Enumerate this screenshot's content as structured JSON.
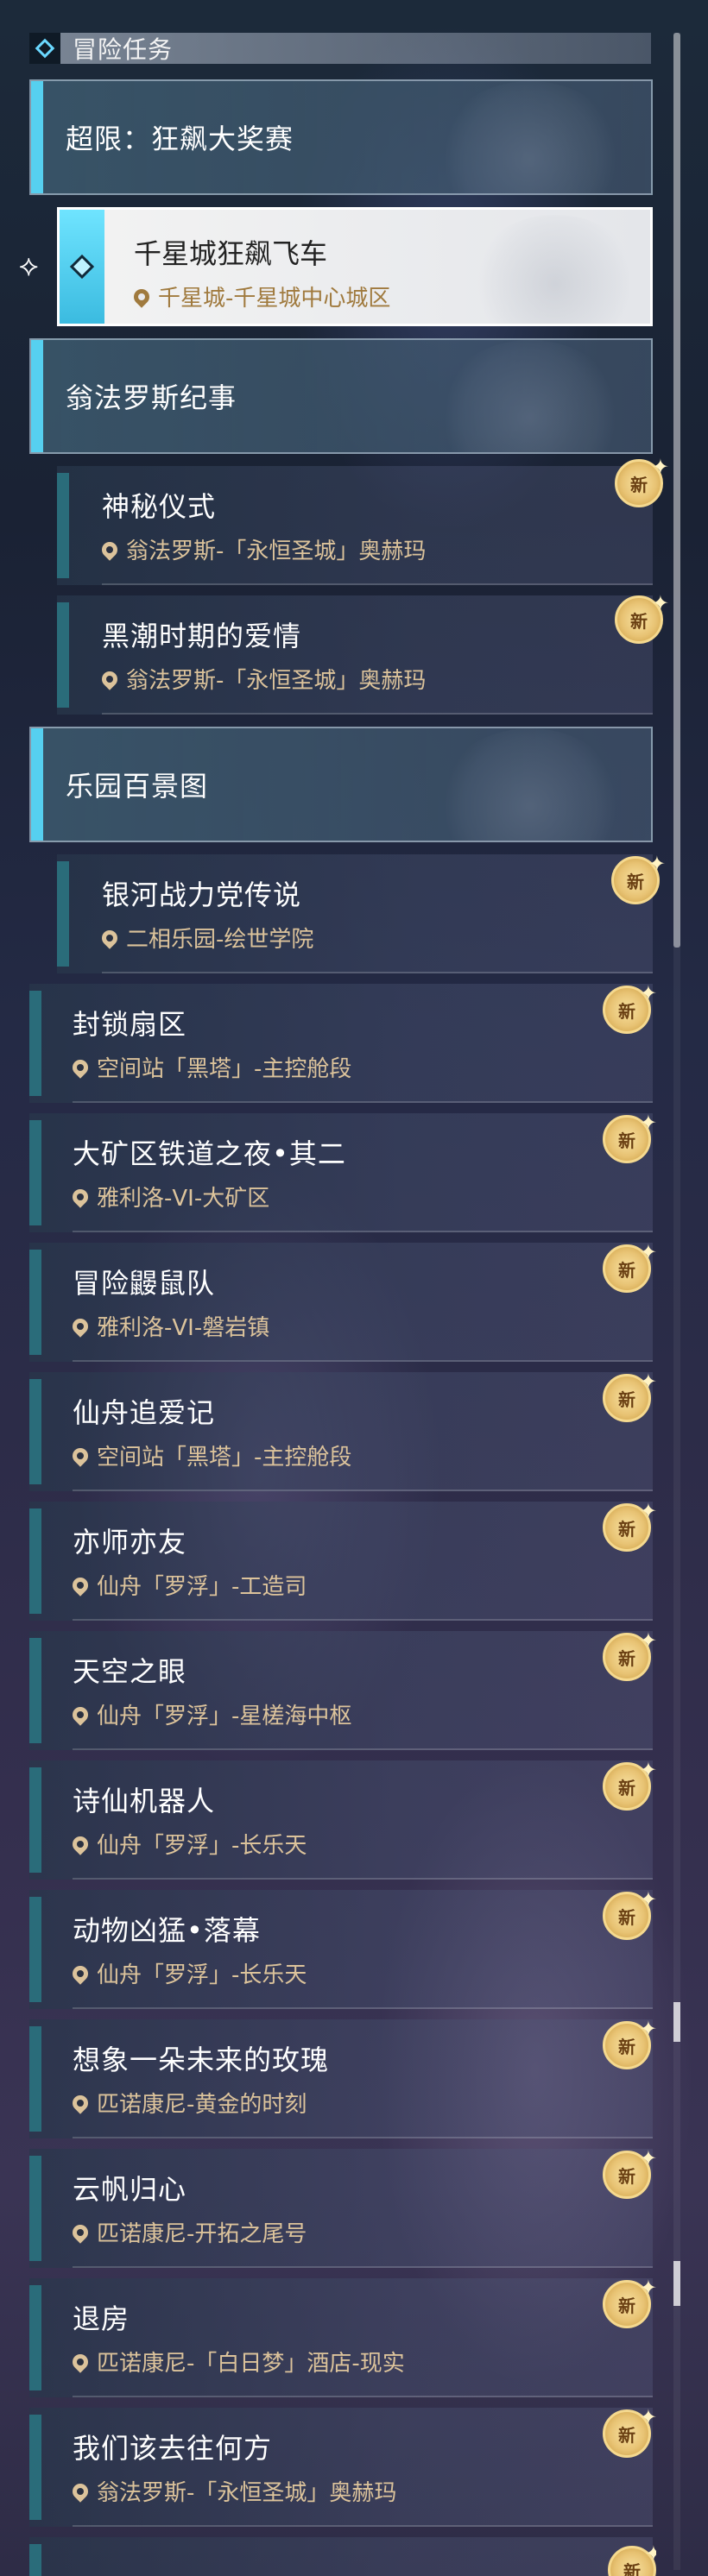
{
  "header": {
    "title": "冒险任务"
  },
  "categories": [
    {
      "label": "超限：狂飙大奖赛"
    },
    {
      "label": "翁法罗斯纪事"
    },
    {
      "label": "乐园百景图"
    }
  ],
  "selected_quest": {
    "title": "千星城狂飙飞车",
    "location": "千星城-千星城中心城区"
  },
  "quests": [
    {
      "title": "神秘仪式",
      "location": "翁法罗斯-「永恒圣城」奥赫玛",
      "badge": "新"
    },
    {
      "title": "黑潮时期的爱情",
      "location": "翁法罗斯-「永恒圣城」奥赫玛",
      "badge": "新"
    },
    {
      "title": "银河战力党传说",
      "location": "二相乐园-绘世学院",
      "badge": "新"
    },
    {
      "title": "封锁扇区",
      "location": "空间站「黑塔」-主控舱段",
      "badge": "新"
    },
    {
      "title": "大矿区铁道之夜•其二",
      "location": "雅利洛-VI-大矿区",
      "badge": "新"
    },
    {
      "title": "冒险鼹鼠队",
      "location": "雅利洛-VI-磐岩镇",
      "badge": "新"
    },
    {
      "title": "仙舟追爱记",
      "location": "空间站「黑塔」-主控舱段",
      "badge": "新"
    },
    {
      "title": "亦师亦友",
      "location": "仙舟「罗浮」-工造司",
      "badge": "新"
    },
    {
      "title": "天空之眼",
      "location": "仙舟「罗浮」-星槎海中枢",
      "badge": "新"
    },
    {
      "title": "诗仙机器人",
      "location": "仙舟「罗浮」-长乐天",
      "badge": "新"
    },
    {
      "title": "动物凶猛•落幕",
      "location": "仙舟「罗浮」-长乐天",
      "badge": "新"
    },
    {
      "title": "想象一朵未来的玫瑰",
      "location": "匹诺康尼-黄金的时刻",
      "badge": "新"
    },
    {
      "title": "云帆归心",
      "location": "匹诺康尼-开拓之尾号",
      "badge": "新"
    },
    {
      "title": "退房",
      "location": "匹诺康尼-「白日梦」酒店-现实",
      "badge": "新"
    },
    {
      "title": "我们该去往何方",
      "location": "翁法罗斯-「永恒圣城」奥赫玛",
      "badge": "新"
    },
    {
      "badge": "新"
    }
  ],
  "colors": {
    "accent": "#56d0f0",
    "location_text": "#dcc39b",
    "badge_gold": "#e8c374"
  }
}
